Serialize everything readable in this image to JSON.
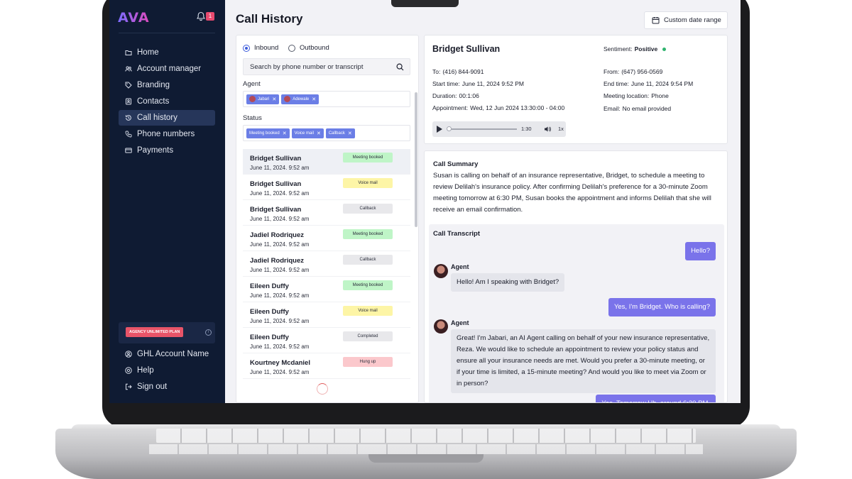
{
  "sidebar": {
    "logo": "AVA",
    "notifications_count": "1",
    "nav": [
      {
        "label": "Home",
        "icon": "folder-icon"
      },
      {
        "label": "Account manager",
        "icon": "users-icon"
      },
      {
        "label": "Branding",
        "icon": "tag-icon"
      },
      {
        "label": "Contacts",
        "icon": "contacts-icon"
      },
      {
        "label": "Call history",
        "icon": "history-icon"
      },
      {
        "label": "Phone numbers",
        "icon": "phone-icon"
      },
      {
        "label": "Payments",
        "icon": "card-icon"
      }
    ],
    "active_item": "Call history",
    "plan_badge": "AGENCY UNLIMITED PLAN",
    "account": "GHL Account Name",
    "help": "Help",
    "sign_out": "Sign out"
  },
  "header": {
    "title": "Call History",
    "date_range_label": "Custom date range"
  },
  "filters": {
    "direction_options": [
      "Inbound",
      "Outbound"
    ],
    "direction_selected": "Inbound",
    "search_placeholder": "Search by phone number or transcript",
    "agent_label": "Agent",
    "agents": [
      "Jabari",
      "Adewale"
    ],
    "status_label": "Status",
    "statuses": [
      "Meeting booked",
      "Voice mail",
      "Callback"
    ]
  },
  "calls": [
    {
      "name": "Bridget Sullivan",
      "when": "June 11, 2024. 9:52 am",
      "status": "Meeting booked",
      "status_color": "#bff5c7"
    },
    {
      "name": "Bridget Sullivan",
      "when": "June 11, 2024. 9:52 am",
      "status": "Voice mail",
      "status_color": "#fdf5a6"
    },
    {
      "name": "Bridget Sullivan",
      "when": "June 11, 2024. 9:52 am",
      "status": "Callback",
      "status_color": "#e8e8eb"
    },
    {
      "name": "Jadiel Rodriquez",
      "when": "June 11, 2024. 9:52 am",
      "status": "Meeting booked",
      "status_color": "#bff5c7"
    },
    {
      "name": "Jadiel Rodriquez",
      "when": "June 11, 2024. 9:52 am",
      "status": "Callback",
      "status_color": "#e8e8eb"
    },
    {
      "name": "Eileen Duffy",
      "when": "June 11, 2024. 9:52 am",
      "status": "Meeting booked",
      "status_color": "#bff5c7"
    },
    {
      "name": "Eileen Duffy",
      "when": "June 11, 2024. 9:52 am",
      "status": "Voice mail",
      "status_color": "#fdf5a6"
    },
    {
      "name": "Eileen Duffy",
      "when": "June 11, 2024. 9:52 am",
      "status": "Completed",
      "status_color": "#e8e8eb"
    },
    {
      "name": "Kourtney Mcdaniel",
      "when": "June 11, 2024. 9:52 am",
      "status": "Hung up",
      "status_color": "#fbc8cc"
    }
  ],
  "detail": {
    "name": "Bridget Sullivan",
    "sentiment_label": "Sentiment:",
    "sentiment_value": "Positive",
    "sentiment_color": "#2fb36e",
    "left": [
      {
        "label": "To:",
        "value": "(416) 844-9091"
      },
      {
        "label": "Start time:",
        "value": "June 11, 2024 9:52 PM"
      },
      {
        "label": "Duration:",
        "value": "00:1:06"
      },
      {
        "label": "Appointment:",
        "value": "Wed, 12 Jun 2024 13:30:00 - 04:00"
      }
    ],
    "right": [
      {
        "label": "From:",
        "value": "(647) 956-0569"
      },
      {
        "label": "End time:",
        "value": "June 11, 2024 9:54 PM"
      },
      {
        "label": "Meeting location:",
        "value": "Phone"
      },
      {
        "label": "Email:",
        "value": "No email provided"
      }
    ],
    "player": {
      "duration": "1:30",
      "speed": "1x",
      "progress": 0.0
    }
  },
  "summary": {
    "title": "Call Summary",
    "text": "Susan is calling on behalf of an insurance representative, Bridget, to schedule a meeting to review Delilah's insurance policy. After confirming Delilah's preference for a 30-minute Zoom meeting tomorrow at 6:30 PM, Susan books the appointment and informs Delilah that she will receive an email confirmation."
  },
  "transcript": {
    "title": "Call Transcript",
    "agent_name": "Agent",
    "messages": [
      {
        "role": "user",
        "text": "Hello?"
      },
      {
        "role": "agent",
        "text": "Hello! Am I speaking with Bridget?"
      },
      {
        "role": "user",
        "text": "Yes, I'm Bridget. Who is calling?"
      },
      {
        "role": "agent",
        "text": "Great! I'm Jabari, an AI Agent calling on behalf of your new insurance representative, Reza. We would like to schedule an appointment to review your policy status and ensure all your insurance needs are met. Would you prefer a 30-minute meeting, or if your time is limited, a 15-minute meeting? And would you like to meet via Zoom or in person?"
      },
      {
        "role": "user",
        "text": "Yes. Tomorrow Uh, around 6:30 PM."
      }
    ]
  },
  "colors": {
    "sidebar_bg": "#0f1b33",
    "accent": "#6b7ee6",
    "user_bubble": "#7a73ea",
    "plan_badge": "#e85468"
  }
}
